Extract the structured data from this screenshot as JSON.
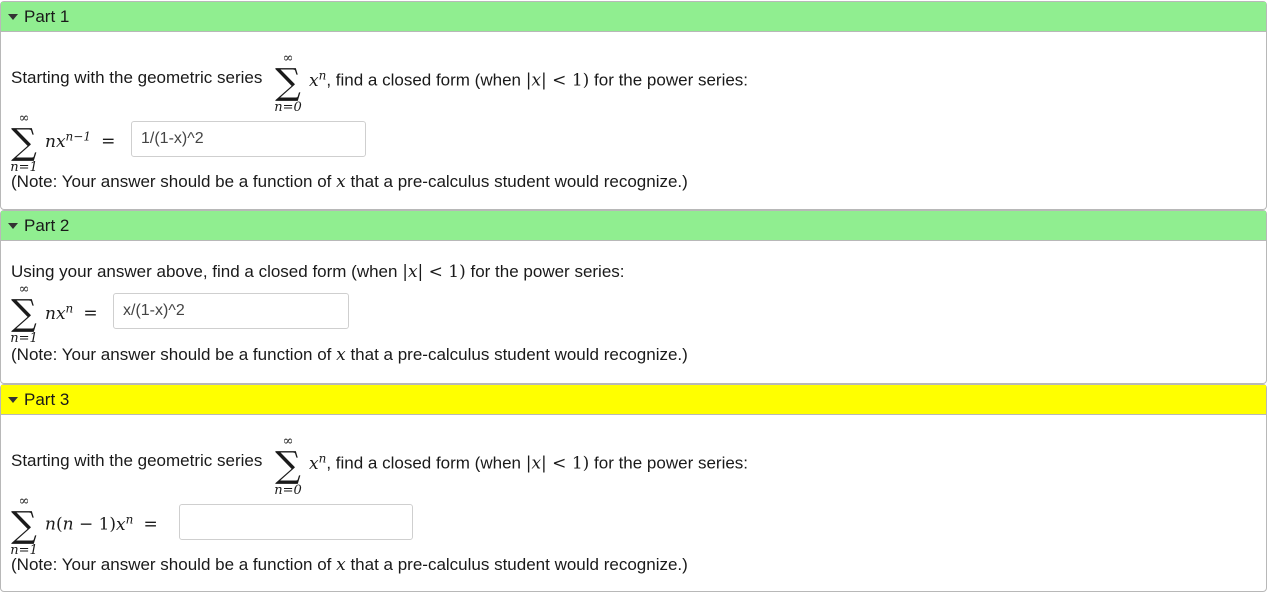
{
  "parts": [
    {
      "title": "Part 1",
      "header_color": "#90ee90",
      "intro_pre": "Starting with the geometric series",
      "intro_post": ", find a closed form (when",
      "intro_end": "for the power series:",
      "answer_value": "1/(1-x)^2",
      "note_pre": "(Note: Your answer should be a function of",
      "note_post": "that a pre-calculus student would recognize.)"
    },
    {
      "title": "Part 2",
      "header_color": "#90ee90",
      "intro_pre": "Using your answer above, find a closed form (when",
      "intro_end": "for the power series:",
      "answer_value": "x/(1-x)^2",
      "note_pre": "(Note: Your answer should be a function of",
      "note_post": "that a pre-calculus student would recognize.)"
    },
    {
      "title": "Part 3",
      "header_color": "#ffff00",
      "intro_pre": "Starting with the geometric series",
      "intro_post": ", find a closed form (when",
      "intro_end": "for the power series:",
      "answer_value": "",
      "note_pre": "(Note: Your answer should be a function of",
      "note_post": "that a pre-calculus student would recognize.)"
    }
  ]
}
